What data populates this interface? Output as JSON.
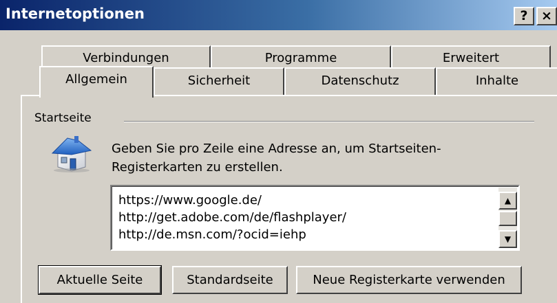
{
  "window": {
    "title": "Internetoptionen",
    "help_label": "?",
    "close_label": "×"
  },
  "tabs": {
    "row1": [
      "Verbindungen",
      "Programme",
      "Erweitert"
    ],
    "row2": [
      "Allgemein",
      "Sicherheit",
      "Datenschutz",
      "Inhalte"
    ],
    "active": "Allgemein"
  },
  "homepage": {
    "group_label": "Startseite",
    "description": "Geben Sie pro Zeile eine Adresse an, um Startseiten-Registerkarten zu erstellen.",
    "description_line1": "Geben Sie pro Zeile eine Adresse an, um Startseiten-",
    "description_line2": "Registerkarten zu erstellen.",
    "urls": [
      "https://www.google.de/",
      "http://get.adobe.com/de/flashplayer/",
      "http://de.msn.com/?ocid=iehp"
    ],
    "icon": "house-icon"
  },
  "buttons": {
    "current_page": "Aktuelle Seite",
    "default_page": "Standardseite",
    "new_tab": "Neue Registerkarte verwenden"
  },
  "colors": {
    "titlebar_start": "#0a246a",
    "titlebar_end": "#a6caf0",
    "face": "#d4d0c8"
  }
}
